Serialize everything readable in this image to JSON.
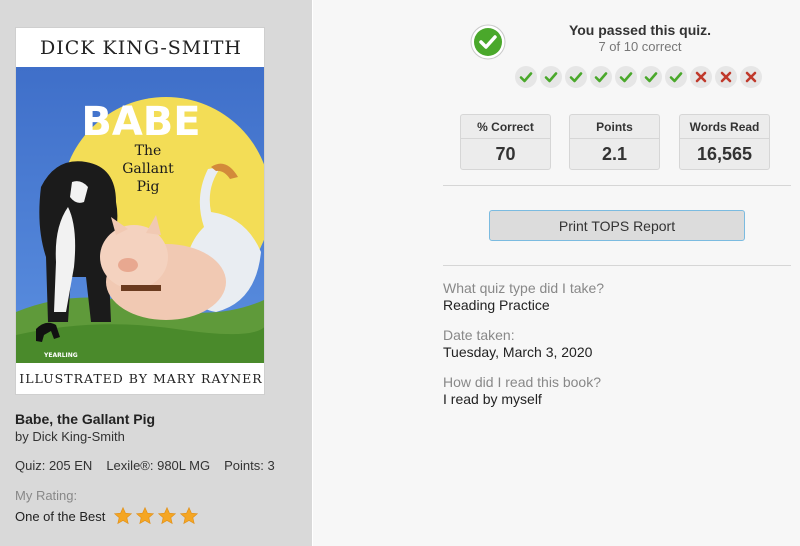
{
  "book": {
    "cover": {
      "top_author": "DICK KING-SMITH",
      "title_main": "BABE",
      "title_line2": "The",
      "title_line3": "Gallant",
      "title_line4": "Pig",
      "publisher_mark": "YEARLING",
      "illustrator_band": "ILLUSTRATED BY MARY RAYNER"
    },
    "title": "Babe, the Gallant Pig",
    "author": "by Dick King-Smith",
    "quiz": "Quiz: 205 EN",
    "lexile": "Lexile®: 980L MG",
    "points": "Points: 3",
    "rating_label": "My Rating:",
    "rating_value": "One of the Best",
    "rating_stars": 4
  },
  "result": {
    "title": "You passed this quiz.",
    "subtitle": "7 of 10 correct",
    "answers": [
      "correct",
      "correct",
      "correct",
      "correct",
      "correct",
      "correct",
      "correct",
      "incorrect",
      "incorrect",
      "incorrect"
    ]
  },
  "stats": [
    {
      "label": "% Correct",
      "value": "70"
    },
    {
      "label": "Points",
      "value": "2.1"
    },
    {
      "label": "Words Read",
      "value": "16,565"
    }
  ],
  "print_button": "Print TOPS Report",
  "details": [
    {
      "question": "What quiz type did I take?",
      "answer": "Reading Practice"
    },
    {
      "question": "Date taken:",
      "answer": "Tuesday, March 3, 2020"
    },
    {
      "question": "How did I read this book?",
      "answer": "I read by myself"
    }
  ],
  "colors": {
    "correct": "#4aa82b",
    "incorrect": "#c0392b",
    "star": "#f5a623",
    "left_panel": "#d9d9d9",
    "right_panel": "#f7f7f7",
    "button_border": "#7bbbe0"
  }
}
